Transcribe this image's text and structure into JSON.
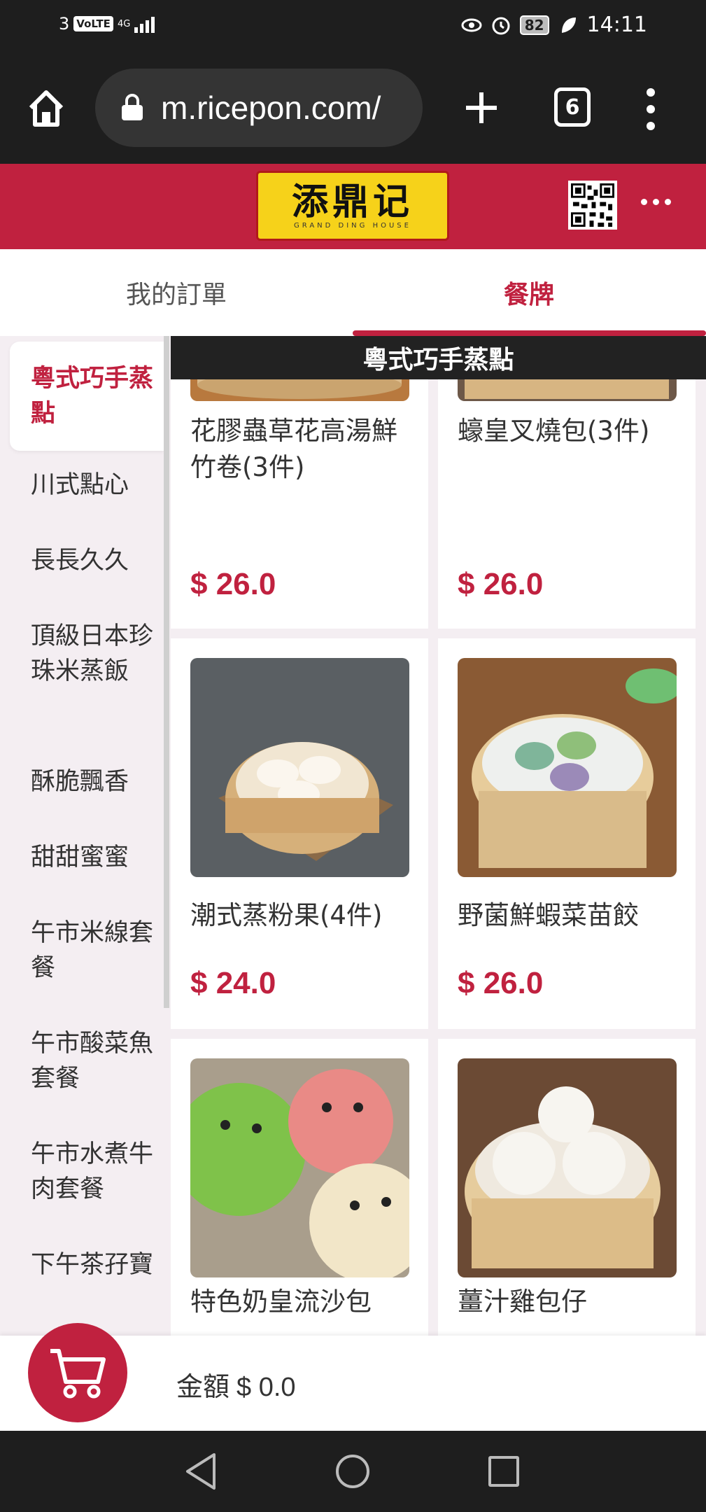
{
  "status_bar": {
    "sim": "3",
    "volte": "VoLTE",
    "network": "4G",
    "battery": "82",
    "time": "14:11"
  },
  "browser": {
    "url": "m.ricepon.com/",
    "tab_count": "6"
  },
  "header": {
    "logo_text": "添鼎记",
    "logo_subtitle": "GRAND DING HOUSE"
  },
  "tabs": [
    {
      "label": "我的訂單"
    },
    {
      "label": "餐牌"
    }
  ],
  "sidebar": {
    "items": [
      {
        "label": "粵式巧手蒸點"
      },
      {
        "label": "川式點心"
      },
      {
        "label": "長長久久"
      },
      {
        "label": "頂級日本珍珠米蒸飯"
      },
      {
        "label": "酥脆飄香"
      },
      {
        "label": "甜甜蜜蜜"
      },
      {
        "label": "午市米線套餐"
      },
      {
        "label": "午市酸菜魚套餐"
      },
      {
        "label": "午市水煮牛肉套餐"
      },
      {
        "label": "下午茶孖寶"
      }
    ]
  },
  "category_header": "粵式巧手蒸點",
  "products": [
    {
      "name": "花膠蟲草花高湯鮮竹卷(3件)",
      "price": "$ 26.0"
    },
    {
      "name": "蠔皇叉燒包(3件)",
      "price": "$ 26.0"
    },
    {
      "name": "潮式蒸粉果(4件)",
      "price": "$ 24.0"
    },
    {
      "name": "野菌鮮蝦菜苗餃",
      "price": "$ 26.0"
    },
    {
      "name": "特色奶皇流沙包",
      "price": ""
    },
    {
      "name": "薑汁雞包仔",
      "price": ""
    }
  ],
  "cart": {
    "label": "金額",
    "amount": "$ 0.0"
  },
  "colors": {
    "brand": "#c0213f",
    "logo_bg": "#f6d21a"
  }
}
